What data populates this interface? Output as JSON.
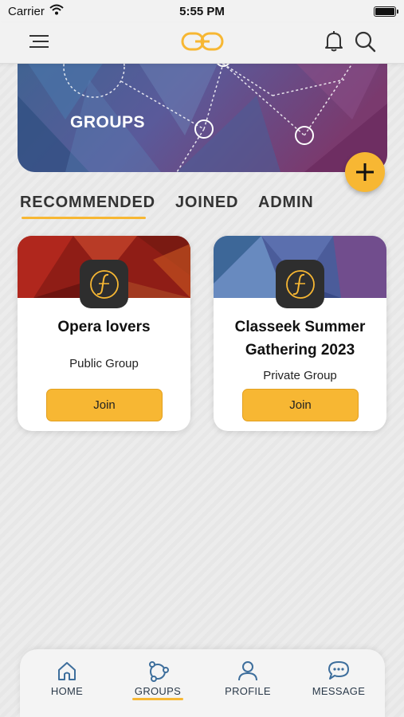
{
  "status_bar": {
    "carrier": "Carrier",
    "time": "5:55 PM"
  },
  "top_nav": {
    "menu_icon": "hamburger-menu-icon",
    "logo": "chain-link-logo",
    "notification_icon": "bell-icon",
    "search_icon": "search-icon"
  },
  "banner": {
    "title": "GROUPS",
    "add_icon": "plus-icon"
  },
  "tabs": [
    {
      "label": "RECOMMENDED",
      "active": true
    },
    {
      "label": "JOINED",
      "active": false
    },
    {
      "label": "ADMIN",
      "active": false
    }
  ],
  "groups": [
    {
      "name": "Opera lovers",
      "type": "Public Group",
      "join_label": "Join",
      "cover": "red-polygon"
    },
    {
      "name": "Classeek Summer Gathering 2023",
      "type": "Private Group",
      "join_label": "Join",
      "cover": "blue-polygon"
    }
  ],
  "bottom_nav": [
    {
      "label": "HOME",
      "icon": "home-icon",
      "active": false
    },
    {
      "label": "GROUPS",
      "icon": "groups-icon",
      "active": true
    },
    {
      "label": "PROFILE",
      "icon": "profile-icon",
      "active": false
    },
    {
      "label": "MESSAGE",
      "icon": "message-icon",
      "active": false
    }
  ],
  "colors": {
    "accent": "#f7b733",
    "icon_blue": "#3d6e9c",
    "logo_dark": "#2e2e2e"
  }
}
